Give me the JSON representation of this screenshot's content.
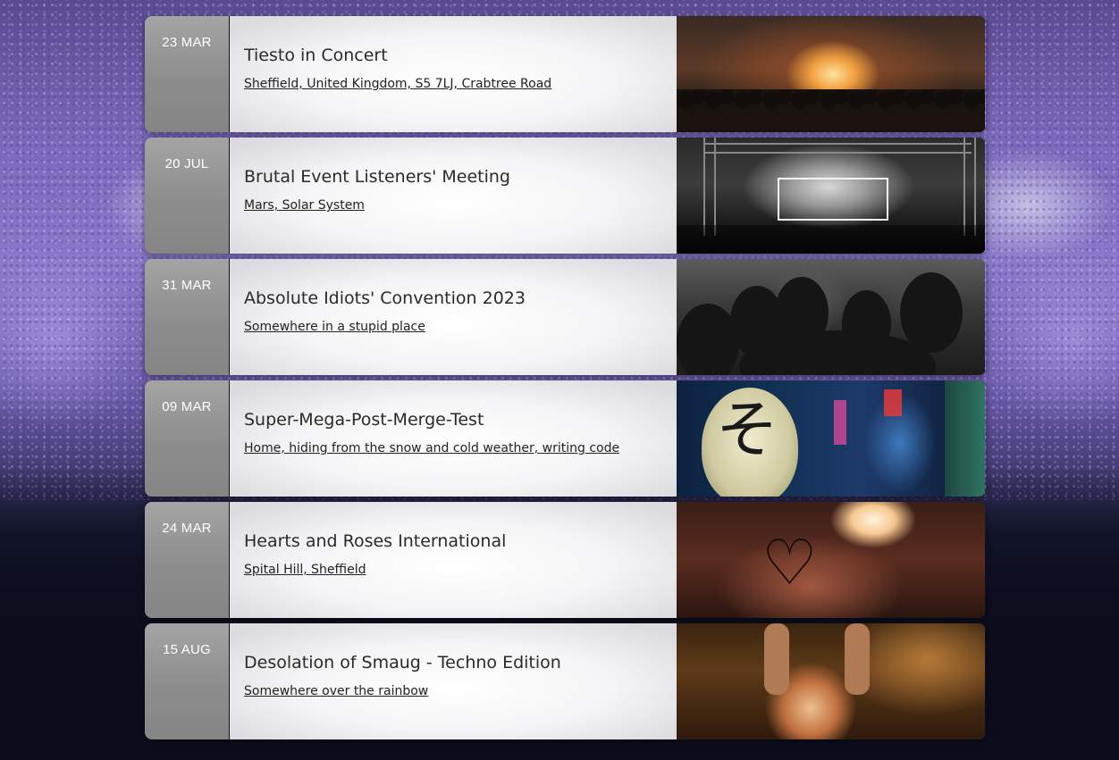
{
  "events": [
    {
      "date": "23 MAR",
      "title": "Tiesto in Concert",
      "location": "Sheffield, United Kingdom, S5 7LJ, Crabtree Road",
      "image": "concert-stage-orange-lights"
    },
    {
      "date": "20 JUL",
      "title": "Brutal Event Listeners' Meeting",
      "location": "Mars, Solar System",
      "image": "black-white-stage-performers"
    },
    {
      "date": "31 MAR",
      "title": "Absolute Idiots' Convention 2023",
      "location": "Somewhere in a stupid place",
      "image": "black-white-crowd"
    },
    {
      "date": "09 MAR",
      "title": "Super-Mega-Post-Merge-Test",
      "location": "Home, hiding from the snow and cold weather, writing code",
      "image": "neon-alley-lantern"
    },
    {
      "date": "24 MAR",
      "title": "Hearts and Roses International",
      "location": "Spital Hill, Sheffield",
      "image": "heart-hands-concert"
    },
    {
      "date": "15 AUG",
      "title": "Desolation of Smaug - Techno Edition",
      "location": "Somewhere over the rainbow",
      "image": "warm-crowd-raised-arms"
    }
  ],
  "lantern_glyph": "そ"
}
